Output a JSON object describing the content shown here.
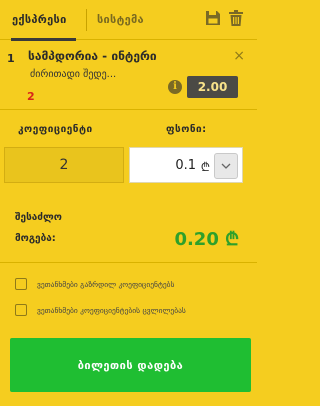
{
  "tabs": {
    "express_label": "ექსპრესი",
    "system_label": "სისტემა",
    "save_icon": "save-icon",
    "trash_icon": "trash-icon"
  },
  "bet_item": {
    "index": "1",
    "title": "სამპდორია - ინტერი",
    "market": "ძირითადი შედე...",
    "count": "2",
    "odds": "2.00",
    "close_glyph": "×",
    "info_glyph": "i"
  },
  "coefficient": {
    "label": "კოეფიციენტი",
    "value": "2"
  },
  "stake": {
    "label": "ფსონი:",
    "value": "0.1",
    "currency": "₾"
  },
  "payout": {
    "label_line1": "შესაძლო",
    "label_line2": "მოგება:",
    "value": "0.20 ₾"
  },
  "options": [
    {
      "label": "ვეთანხმები გაზრდილ კოეფიციენტებს"
    },
    {
      "label": "ვეთანხმები კოეფიციენტების ცვლილებას"
    }
  ],
  "place_bet": {
    "label": "ბილეთის დადება"
  },
  "colors": {
    "background": "#f5cd1f",
    "accent_green": "#1fbe32",
    "payout_green": "#2fa02a",
    "odds_bg": "#4b4a45",
    "count_red": "#d8261a"
  }
}
